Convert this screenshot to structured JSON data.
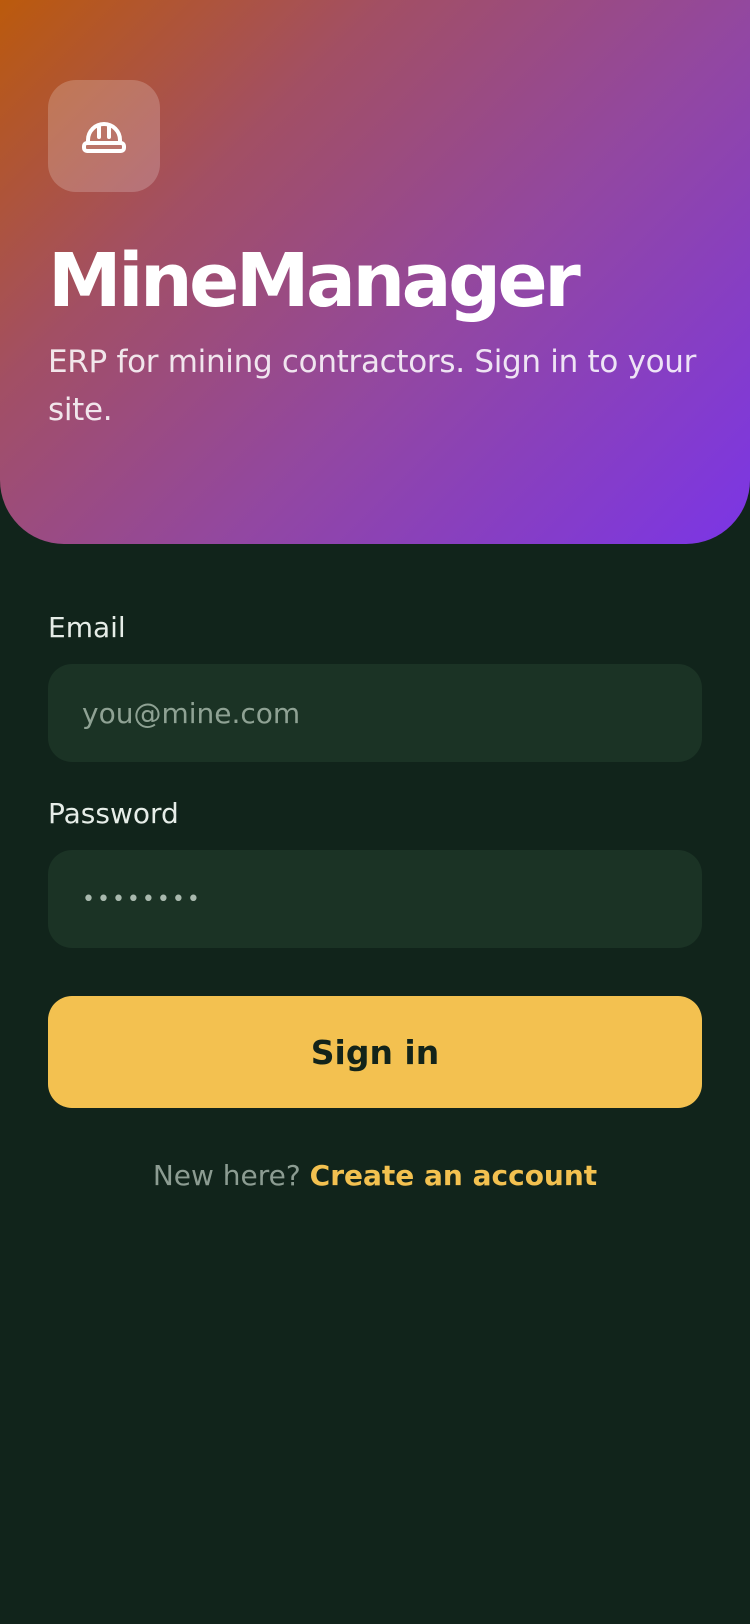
{
  "app": {
    "title": "MineManager",
    "subtitle": "ERP for mining contractors. Sign in to your site.",
    "logo_icon": "hard-hat-icon"
  },
  "form": {
    "email_label": "Email",
    "email_placeholder": "you@mine.com",
    "email_value": "",
    "password_label": "Password",
    "password_value": "••••••••",
    "submit_label": "Sign in"
  },
  "footer": {
    "prompt": "New here?",
    "link_label": "Create an account"
  },
  "colors": {
    "background": "#11241b",
    "field_background": "#1b3325",
    "accent": "#f3c150",
    "gradient_start": "#bb5a0c",
    "gradient_end": "#7b35e6"
  }
}
